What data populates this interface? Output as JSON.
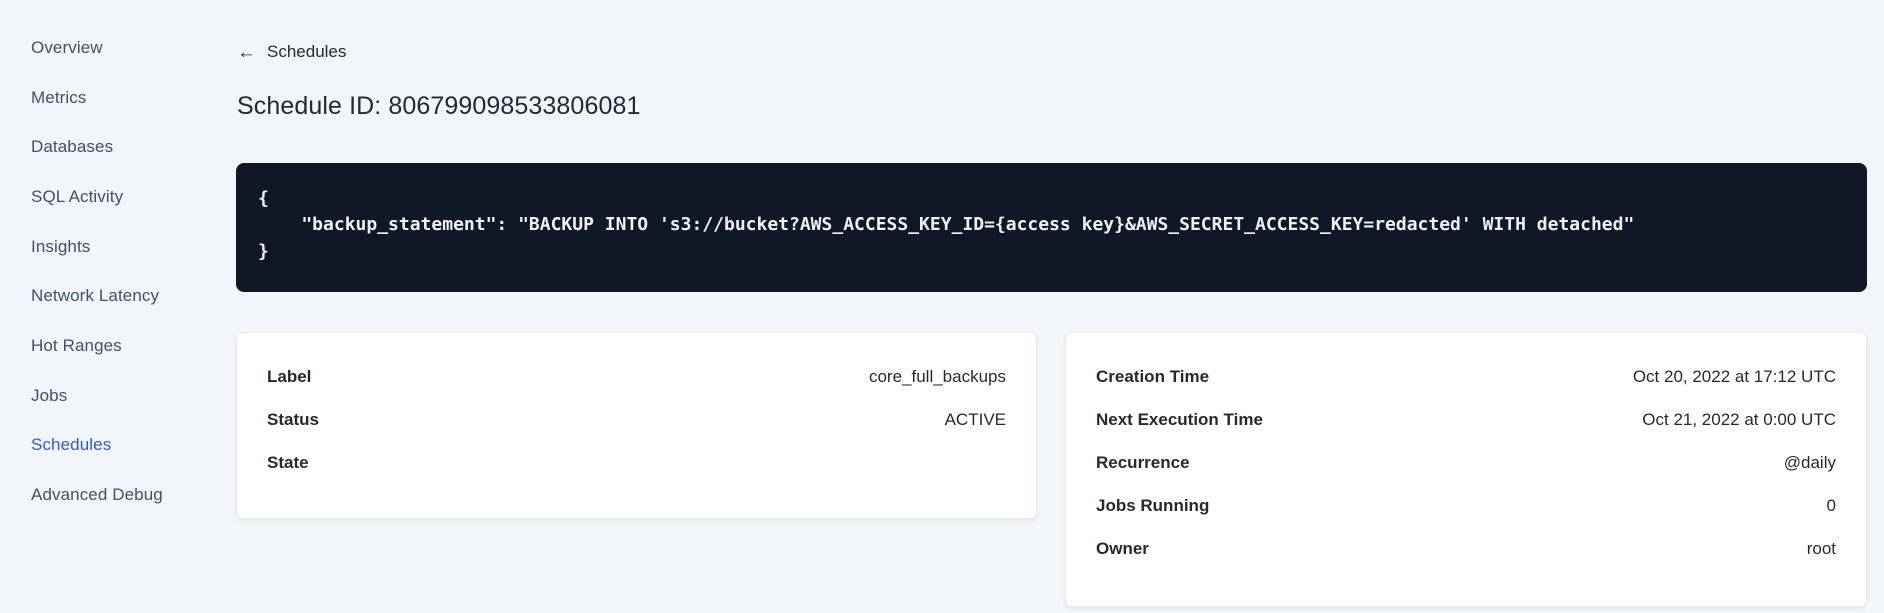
{
  "sidebar": {
    "items": [
      {
        "label": "Overview",
        "active": false
      },
      {
        "label": "Metrics",
        "active": false
      },
      {
        "label": "Databases",
        "active": false
      },
      {
        "label": "SQL Activity",
        "active": false
      },
      {
        "label": "Insights",
        "active": false
      },
      {
        "label": "Network Latency",
        "active": false
      },
      {
        "label": "Hot Ranges",
        "active": false
      },
      {
        "label": "Jobs",
        "active": false
      },
      {
        "label": "Schedules",
        "active": true
      },
      {
        "label": "Advanced Debug",
        "active": false
      }
    ]
  },
  "header": {
    "back_icon": "←",
    "back_label": "Schedules",
    "title": "Schedule ID: 806799098533806081"
  },
  "code": {
    "lines": [
      "{",
      "    \"backup_statement\": \"BACKUP INTO 's3://bucket?AWS_ACCESS_KEY_ID={access key}&AWS_SECRET_ACCESS_KEY=redacted' WITH detached\"",
      "}"
    ]
  },
  "details_card": {
    "rows": [
      {
        "label": "Label",
        "value": "core_full_backups"
      },
      {
        "label": "Status",
        "value": "ACTIVE"
      },
      {
        "label": "State",
        "value": ""
      }
    ]
  },
  "schedule_card": {
    "rows": [
      {
        "label": "Creation Time",
        "value": "Oct 20, 2022 at 17:12 UTC"
      },
      {
        "label": "Next Execution Time",
        "value": "Oct 21, 2022 at 0:00 UTC"
      },
      {
        "label": "Recurrence",
        "value": "@daily"
      },
      {
        "label": "Jobs Running",
        "value": "0"
      },
      {
        "label": "Owner",
        "value": "root"
      }
    ]
  },
  "colors": {
    "page_bg": "#f2f5f9",
    "card_bg": "#ffffff",
    "code_bg": "#101726",
    "code_text": "#eef2f7",
    "accent_blue": "#2a5cdc",
    "text_dark": "#242a35",
    "sidebar_text": "#43506a"
  }
}
